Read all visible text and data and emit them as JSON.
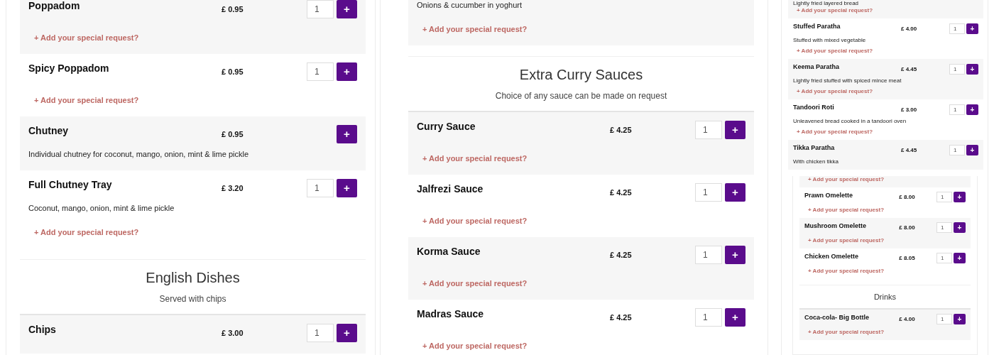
{
  "panels": [
    {
      "kind": "full",
      "sheets": [
        {
          "blocks": [
            {
              "kind": "item",
              "name": "Poppadom",
              "price": "£ 0.95",
              "quantity": "1",
              "button": "+",
              "request": "+ Add your special request?"
            },
            {
              "kind": "item",
              "name": "Spicy Poppadom",
              "price": "£ 0.95",
              "quantity": "1",
              "button": "+",
              "request": "+ Add your special request?"
            },
            {
              "kind": "item",
              "name": "Chutney",
              "price": "£ 0.95",
              "button": "+",
              "description": "Individual chutney for coconut, mango, onion, mint & lime pickle"
            },
            {
              "kind": "item",
              "name": "Full Chutney Tray",
              "price": "£ 3.20",
              "quantity": "1",
              "button": "+",
              "description": "Coconut, mango, onion, mint & lime pickle",
              "request": "+ Add your special request?"
            },
            {
              "kind": "section",
              "title": "English Dishes",
              "subtitle": "Served with chips"
            },
            {
              "kind": "item",
              "name": "Chips",
              "price": "£ 3.00",
              "quantity": "1",
              "button": "+"
            }
          ]
        }
      ]
    },
    {
      "kind": "full",
      "sheets": [
        {
          "blocks": [
            {
              "kind": "item",
              "description": "Onions & cucumber in yoghurt",
              "request": "+ Add your special request?"
            },
            {
              "kind": "section",
              "title": "Extra Curry Sauces",
              "subtitle": "Choice of any sauce can be made on request"
            },
            {
              "kind": "item",
              "name": "Curry Sauce",
              "price": "£ 4.25",
              "quantity": "1",
              "button": "+",
              "request": "+ Add your special request?"
            },
            {
              "kind": "item",
              "name": "Jalfrezi Sauce",
              "price": "£ 4.25",
              "quantity": "1",
              "button": "+",
              "request": "+ Add your special request?"
            },
            {
              "kind": "item",
              "name": "Korma Sauce",
              "price": "£ 4.25",
              "quantity": "1",
              "button": "+",
              "request": "+ Add your special request?"
            },
            {
              "kind": "item",
              "name": "Madras Sauce",
              "price": "£ 4.25",
              "quantity": "1",
              "button": "+",
              "request": "+ Add your special request?"
            }
          ]
        }
      ]
    },
    {
      "kind": "mini",
      "sheets": [
        {
          "blocks": [
            {
              "kind": "item",
              "description": "Lightly fried layered bread",
              "request": "+ Add your special request?"
            },
            {
              "kind": "item",
              "name": "Stuffed Paratha",
              "price": "£ 4.00",
              "quantity": "1",
              "button": "+",
              "description": "Stuffed with mixed vegetable",
              "request": "+ Add your special request?"
            },
            {
              "kind": "item",
              "name": "Keema Paratha",
              "price": "£ 4.45",
              "quantity": "1",
              "button": "+",
              "description": "Lightly fried stuffed with spiced mince meat",
              "request": "+ Add your special request?"
            },
            {
              "kind": "item",
              "name": "Tandoori Roti",
              "price": "£ 3.00",
              "quantity": "1",
              "button": "+",
              "description": "Unleavened bread cooked in a tandoori oven",
              "request": "+ Add your special request?"
            },
            {
              "kind": "item",
              "name": "Tikka Paratha",
              "price": "£ 4.45",
              "quantity": "1",
              "button": "+",
              "description": "With chicken tikka"
            }
          ]
        },
        {
          "blocks": [
            {
              "kind": "item",
              "request": "+ Add your special request?"
            },
            {
              "kind": "item",
              "name": "Prawn Omelette",
              "price": "£ 8.00",
              "quantity": "1",
              "button": "+",
              "request": "+ Add your special request?"
            },
            {
              "kind": "item",
              "name": "Mushroom Omelette",
              "price": "£ 8.00",
              "quantity": "1",
              "button": "+",
              "request": "+ Add your special request?"
            },
            {
              "kind": "item",
              "name": "Chicken Omelette",
              "price": "£ 8.05",
              "quantity": "1",
              "button": "+",
              "request": "+ Add your special request?"
            },
            {
              "kind": "section",
              "title": "Drinks"
            },
            {
              "kind": "item",
              "name": "Coca-cola- Big Bottle",
              "price": "£ 4.00",
              "quantity": "1",
              "button": "+",
              "request": "+ Add your special request?"
            }
          ]
        }
      ]
    }
  ]
}
